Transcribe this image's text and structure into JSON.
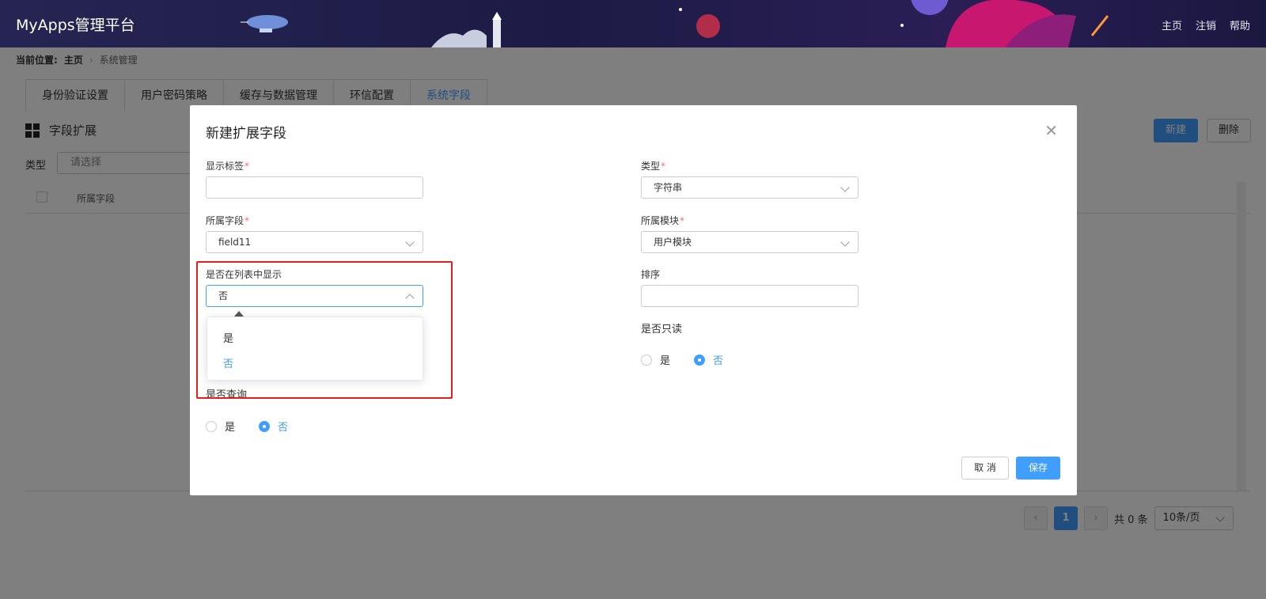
{
  "header": {
    "app_title": "MyApps管理平台",
    "nav": [
      "主页",
      "注销",
      "帮助"
    ]
  },
  "breadcrumb": {
    "prefix": "当前位置:",
    "home": "主页",
    "current": "系统管理"
  },
  "tabs": [
    "身份验证设置",
    "用户密码策略",
    "缓存与数据管理",
    "环信配置",
    "系统字段"
  ],
  "active_tab_index": 4,
  "section": {
    "title": "字段扩展",
    "new_button": "新建",
    "delete_button": "删除"
  },
  "filter": {
    "label": "类型",
    "placeholder": "请选择"
  },
  "table": {
    "column": "所属字段"
  },
  "pager": {
    "page": "1",
    "total": "共 0 条",
    "page_size": "10条/页"
  },
  "modal": {
    "title": "新建扩展字段",
    "display_label": {
      "label": "显示标签",
      "value": ""
    },
    "type": {
      "label": "类型",
      "value": "字符串"
    },
    "field": {
      "label": "所属字段",
      "value": "field11"
    },
    "module": {
      "label": "所属模块",
      "value": "用户模块"
    },
    "show_in_list": {
      "label": "是否在列表中显示",
      "value": "否",
      "options": [
        "是",
        "否"
      ],
      "selected_option": "否"
    },
    "sort": {
      "label": "排序",
      "value": ""
    },
    "readonly": {
      "label": "是否只读",
      "yes": "是",
      "no": "否",
      "selected": "否"
    },
    "query": {
      "label": "是否查询",
      "yes": "是",
      "no": "否",
      "selected": "否"
    },
    "cancel_button": "取 消",
    "save_button": "保存"
  },
  "colors": {
    "primary": "#409eff",
    "highlight_border": "#e0201d",
    "header_bg": "#1d1b45"
  }
}
